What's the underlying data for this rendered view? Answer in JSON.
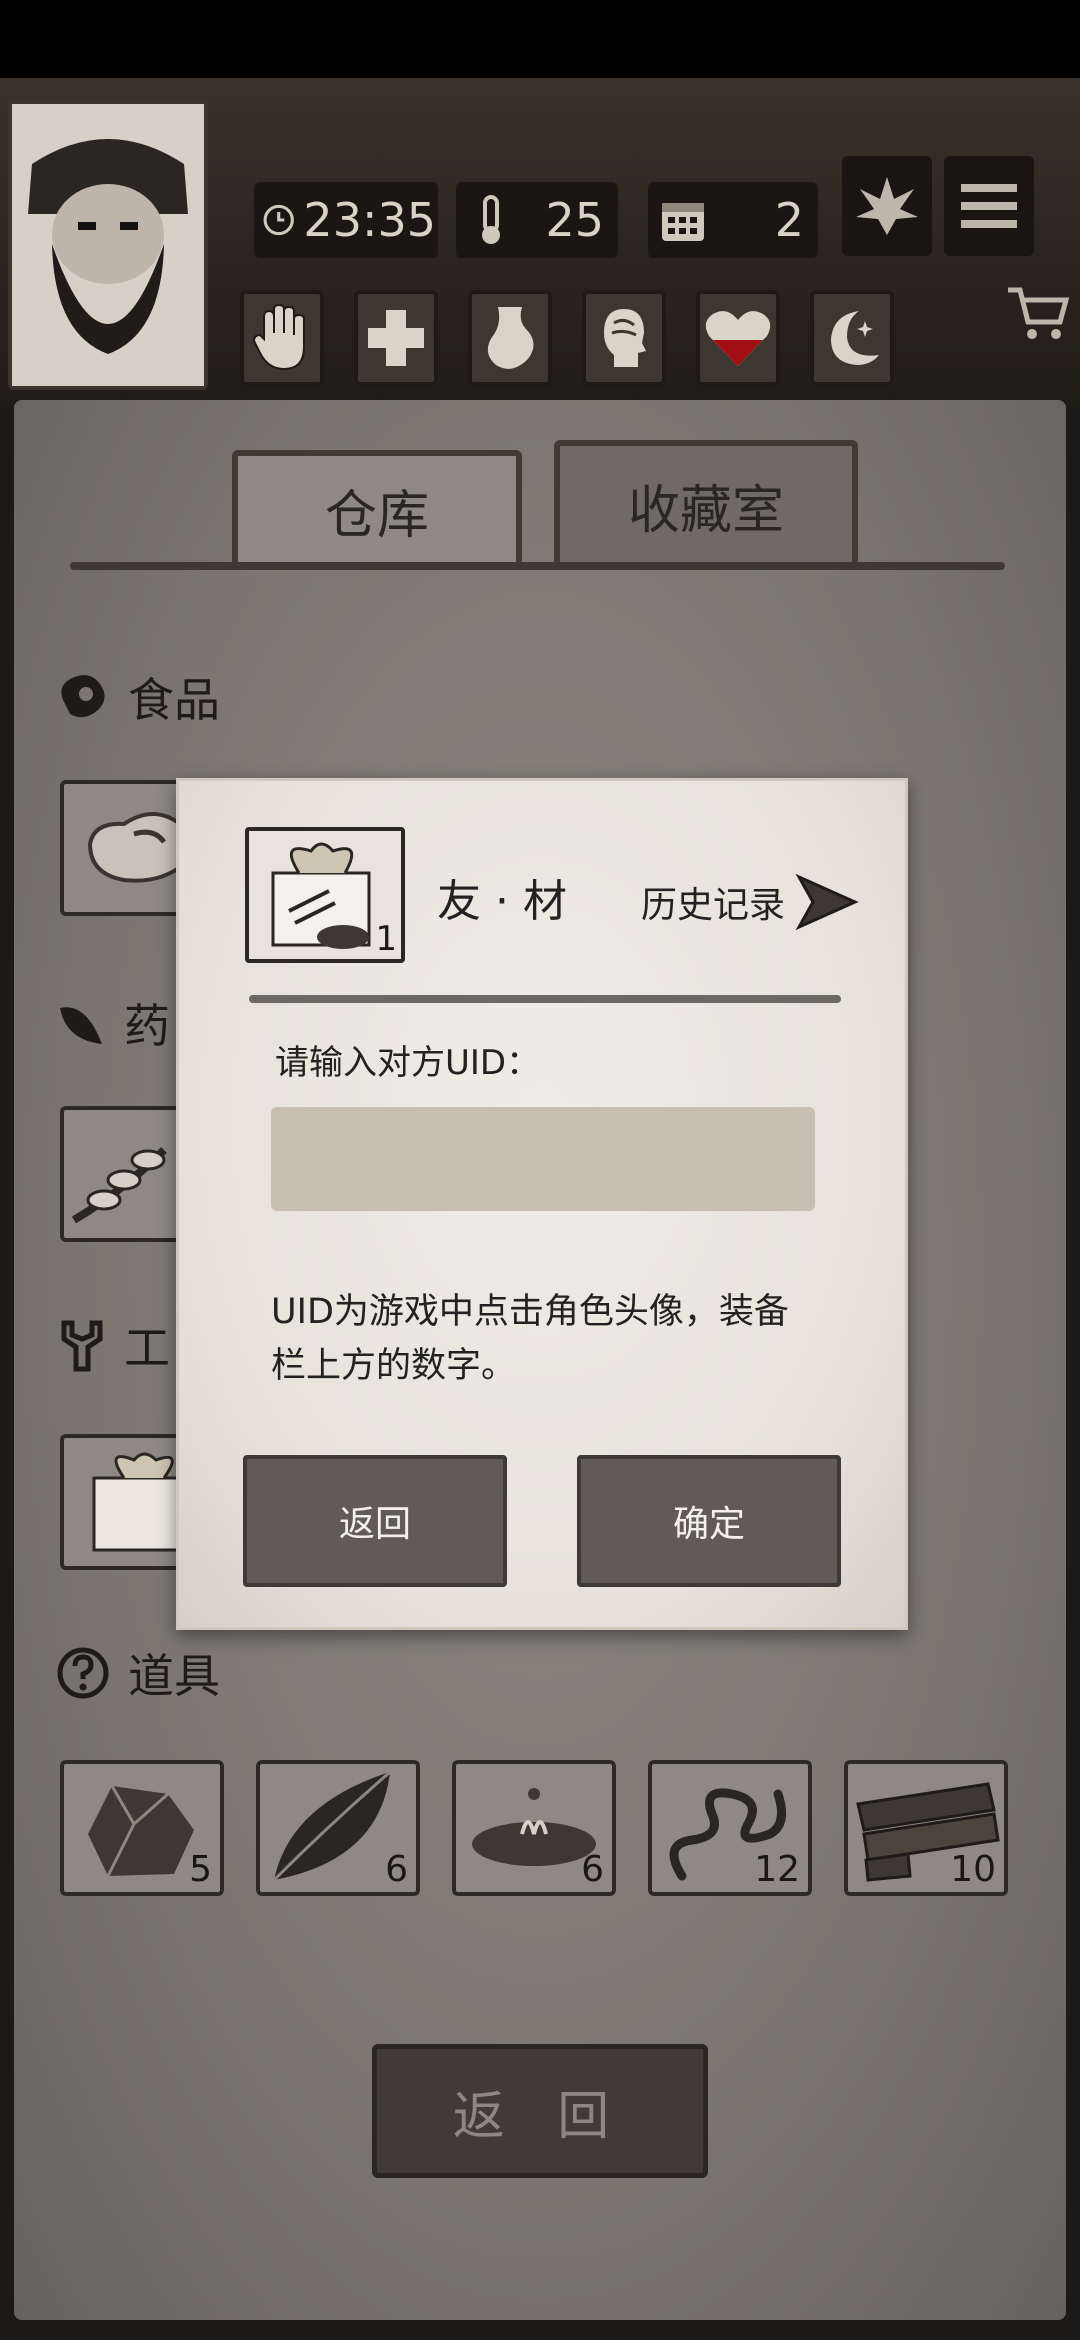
{
  "hud": {
    "time": "23:35",
    "temperature": "25",
    "day": "2",
    "icons": [
      "clock-icon",
      "thermometer-icon",
      "calendar-icon",
      "leaf-icon",
      "menu-icon",
      "cart-icon"
    ],
    "status_icons": [
      "hand-icon",
      "health-cross-icon",
      "stomach-icon",
      "brain-icon",
      "heart-icon",
      "moon-icon"
    ]
  },
  "tabs": [
    {
      "label": "仓库",
      "active": false
    },
    {
      "label": "收藏室",
      "active": true
    }
  ],
  "sections": {
    "food": {
      "title": "食品"
    },
    "medicine": {
      "title": "药"
    },
    "tools": {
      "title": "工"
    },
    "props": {
      "title": "道具",
      "items": [
        {
          "icon": "rock-icon",
          "count": "5"
        },
        {
          "icon": "leaf-item-icon",
          "count": "6"
        },
        {
          "icon": "water-puddle-icon",
          "count": "6"
        },
        {
          "icon": "worm-icon",
          "count": "12"
        },
        {
          "icon": "wood-planks-icon",
          "count": "10"
        }
      ]
    }
  },
  "bottom_button": "返 回",
  "dialog": {
    "item_name": "友 · 材",
    "item_count": "1",
    "history_label": "历史记录",
    "prompt": "请输入对方UID：",
    "input_value": "",
    "hint_line1": "UID为游戏中点击角色头像，装备",
    "hint_line2": "栏上方的数字。",
    "cancel_label": "返回",
    "confirm_label": "确定"
  },
  "colors": {
    "panel": "#7b7770",
    "dialog": "#e6e2da",
    "dialog_button": "#605b55",
    "input": "#c8bfb3"
  }
}
